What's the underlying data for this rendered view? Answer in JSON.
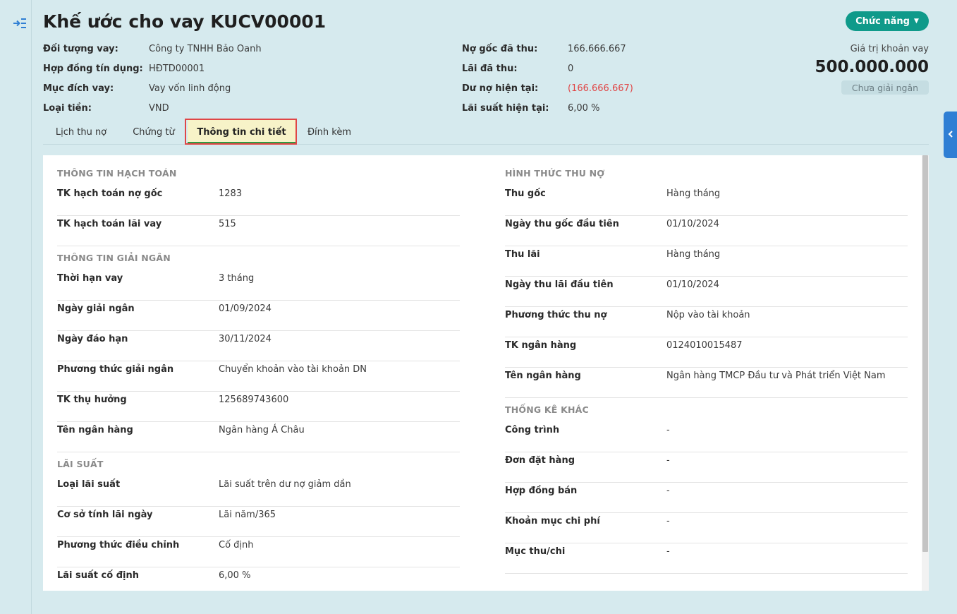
{
  "header": {
    "title": "Khế ước cho vay KUCV00001",
    "function_button": "Chức năng",
    "caret": "▼"
  },
  "summary_left": [
    {
      "label": "Đối tượng vay:",
      "value": "Công ty TNHH Bảo Oanh"
    },
    {
      "label": "Hợp đồng tín dụng:",
      "value": "HĐTD00001"
    },
    {
      "label": "Mục đích vay:",
      "value": "Vay vốn linh động"
    },
    {
      "label": "Loại tiền:",
      "value": "VND"
    }
  ],
  "summary_right": [
    {
      "label": "Nợ gốc đã thu:",
      "value": "166.666.667"
    },
    {
      "label": "Lãi đã thu:",
      "value": "0"
    },
    {
      "label": "Dư nợ hiện tại:",
      "value": "(166.666.667)"
    },
    {
      "label": "Lãi suất hiện tại:",
      "value": "6,00 %"
    }
  ],
  "loan": {
    "caption": "Giá trị khoản vay",
    "amount": "500.000.000",
    "status": "Chưa giải ngân"
  },
  "tabs": [
    {
      "label": "Lịch thu nợ"
    },
    {
      "label": "Chứng từ"
    },
    {
      "label": "Thông tin chi tiết"
    },
    {
      "label": "Đính kèm"
    }
  ],
  "left": {
    "accounting": {
      "title": "THÔNG TIN HẠCH TOÁN",
      "rows": [
        {
          "label": "TK hạch toán nợ gốc",
          "value": "1283"
        },
        {
          "label": "TK hạch toán lãi vay",
          "value": "515"
        }
      ]
    },
    "disbursement": {
      "title": "THÔNG TIN GIẢI NGÂN",
      "rows": [
        {
          "label": "Thời hạn vay",
          "value": "3 tháng"
        },
        {
          "label": "Ngày giải ngân",
          "value": "01/09/2024"
        },
        {
          "label": "Ngày đáo hạn",
          "value": "30/11/2024"
        },
        {
          "label": "Phương thức giải ngân",
          "value": "Chuyển khoản vào tài khoản DN"
        },
        {
          "label": "TK thụ hưởng",
          "value": "125689743600"
        },
        {
          "label": "Tên ngân hàng",
          "value": "Ngân hàng Á Châu"
        }
      ]
    },
    "interest": {
      "title": "LÃI SUẤT",
      "rows": [
        {
          "label": "Loại lãi suất",
          "value": "Lãi suất trên dư nợ giảm dần"
        },
        {
          "label": "Cơ sở tính lãi ngày",
          "value": "Lãi năm/365"
        },
        {
          "label": "Phương thức điều chỉnh",
          "value": "Cố định"
        },
        {
          "label": "Lãi suất cố định",
          "value": "6,00 %"
        }
      ]
    }
  },
  "right": {
    "repayment": {
      "title": "HÌNH THỨC THU NỢ",
      "rows": [
        {
          "label": "Thu gốc",
          "value": "Hàng tháng"
        },
        {
          "label": "Ngày thu gốc đầu tiên",
          "value": "01/10/2024"
        },
        {
          "label": "Thu lãi",
          "value": "Hàng tháng"
        },
        {
          "label": "Ngày thu lãi đầu tiên",
          "value": "01/10/2024"
        },
        {
          "label": "Phương thức thu nợ",
          "value": "Nộp vào tài khoản"
        },
        {
          "label": "TK ngân hàng",
          "value": "0124010015487"
        },
        {
          "label": "Tên ngân hàng",
          "value": "Ngân hàng TMCP Đầu tư và Phát triển Việt Nam"
        }
      ]
    },
    "other": {
      "title": "THỐNG KÊ KHÁC",
      "rows": [
        {
          "label": "Công trình",
          "value": "-"
        },
        {
          "label": "Đơn đặt hàng",
          "value": "-"
        },
        {
          "label": "Hợp đồng bán",
          "value": "-"
        },
        {
          "label": "Khoản mục chi phí",
          "value": "-"
        },
        {
          "label": "Mục thu/chi",
          "value": "-"
        }
      ]
    }
  },
  "colors": {
    "accent": "#0f9a8a",
    "negative": "#e04646",
    "active_tab_bg": "#f7f3c8",
    "active_tab_underline": "#2f9a42"
  }
}
